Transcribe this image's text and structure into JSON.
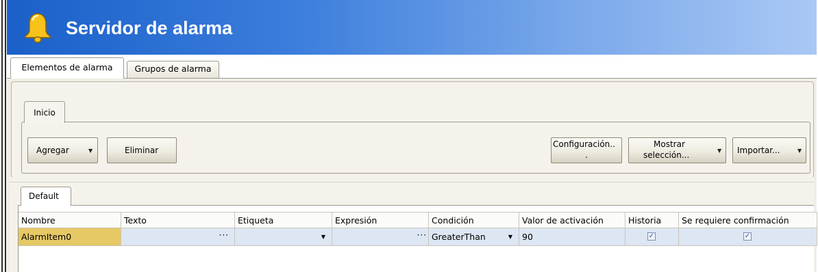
{
  "header": {
    "title": "Servidor de alarma",
    "icon": "bell-icon",
    "colors": {
      "gradient_start": "#1b60c9",
      "gradient_end": "#aac8f5",
      "bell": "#f7c21b"
    }
  },
  "top_tabs": [
    {
      "label": "Elementos de alarma",
      "active": true
    },
    {
      "label": "Grupos de alarma",
      "active": false
    }
  ],
  "ribbon": {
    "tab": "Inicio",
    "buttons": {
      "agregar": "Agregar",
      "eliminar": "Eliminar",
      "configuracion_1": "Configuración..",
      "configuracion_2": ".",
      "mostrar_1": "Mostrar",
      "mostrar_2": "selección...",
      "importar": "Importar..."
    }
  },
  "grid": {
    "tab": "Default",
    "columns": [
      "Nombre",
      "Texto",
      "Etiqueta",
      "Expresión",
      "Condición",
      "Valor de activación",
      "Historia",
      "Se requiere confirmación"
    ],
    "rows": [
      {
        "nombre": "AlarmItem0",
        "texto": "",
        "etiqueta": "",
        "expresion": "",
        "condicion": "GreaterThan",
        "valor": "90",
        "historia": true,
        "confirmacion": true
      }
    ],
    "colors": {
      "selected_name_cell": "#e6c865",
      "row_background": "#dde6f3"
    }
  }
}
